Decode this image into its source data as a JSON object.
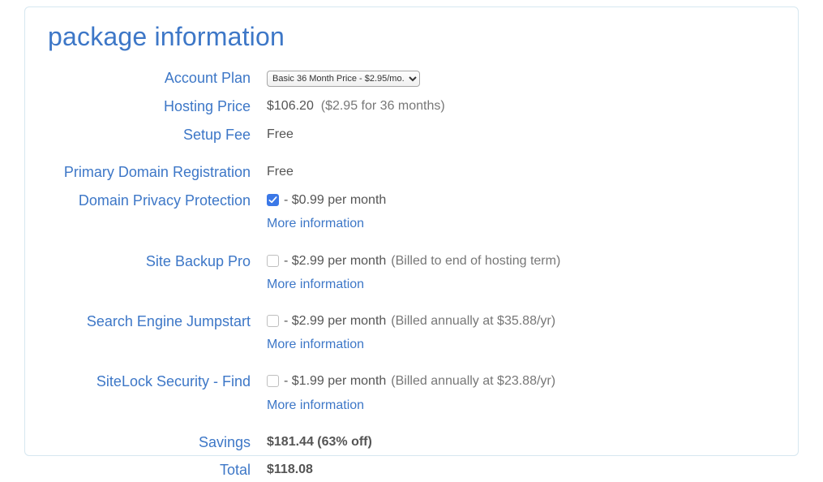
{
  "title": "package information",
  "accountPlan": {
    "label": "Account Plan",
    "selected": "Basic 36 Month Price - $2.95/mo."
  },
  "hostingPrice": {
    "label": "Hosting Price",
    "amount": "$106.20",
    "detail": "($2.95 for 36 months)"
  },
  "setupFee": {
    "label": "Setup Fee",
    "value": "Free"
  },
  "primaryDomain": {
    "label": "Primary Domain Registration",
    "value": "Free"
  },
  "domainPrivacy": {
    "label": "Domain Privacy Protection",
    "checked": true,
    "priceText": "- $0.99 per month",
    "moreInfo": "More information"
  },
  "siteBackup": {
    "label": "Site Backup Pro",
    "checked": false,
    "priceText": "- $2.99 per month",
    "billingNote": "(Billed to end of hosting term)",
    "moreInfo": "More information"
  },
  "searchEngine": {
    "label": "Search Engine Jumpstart",
    "checked": false,
    "priceText": "- $2.99 per month",
    "billingNote": "(Billed annually at $35.88/yr)",
    "moreInfo": "More information"
  },
  "sitelock": {
    "label": "SiteLock Security - Find",
    "checked": false,
    "priceText": "- $1.99 per month",
    "billingNote": "(Billed annually at $23.88/yr)",
    "moreInfo": "More information"
  },
  "savings": {
    "label": "Savings",
    "value": "$181.44 (63% off)"
  },
  "total": {
    "label": "Total",
    "value": "$118.08"
  }
}
